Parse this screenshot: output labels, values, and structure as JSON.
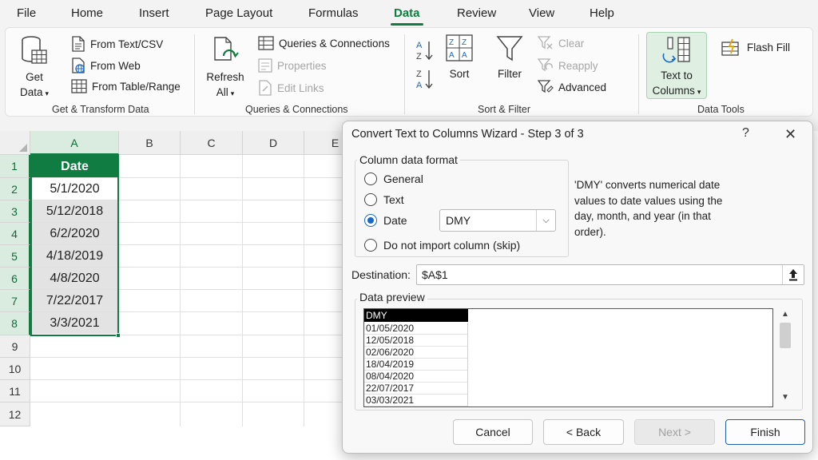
{
  "menu": {
    "tabs": [
      "File",
      "Home",
      "Insert",
      "Page Layout",
      "Formulas",
      "Data",
      "Review",
      "View",
      "Help"
    ],
    "active": "Data"
  },
  "ribbon": {
    "get_transform": {
      "get_data_line1": "Get",
      "get_data_line2": "Data",
      "from_text_csv": "From Text/CSV",
      "from_web": "From Web",
      "from_table_range": "From Table/Range",
      "label": "Get & Transform Data"
    },
    "queries": {
      "refresh_line1": "Refresh",
      "refresh_line2": "All",
      "queries_connections": "Queries & Connections",
      "properties": "Properties",
      "edit_links": "Edit Links",
      "label": "Queries & Connections"
    },
    "sort_filter": {
      "sort": "Sort",
      "filter": "Filter",
      "clear": "Clear",
      "reapply": "Reapply",
      "advanced": "Advanced",
      "label": "Sort & Filter"
    },
    "data_tools": {
      "ttc_line1": "Text to",
      "ttc_line2": "Columns",
      "flash_fill": "Flash Fill",
      "label": "Data Tools"
    }
  },
  "sheet": {
    "columns": [
      "A",
      "B",
      "C",
      "D",
      "E"
    ],
    "rows": [
      "1",
      "2",
      "3",
      "4",
      "5",
      "6",
      "7",
      "8",
      "9",
      "10",
      "11",
      "12"
    ],
    "header": "Date",
    "dates": [
      "5/1/2020",
      "5/12/2018",
      "6/2/2020",
      "4/18/2019",
      "4/8/2020",
      "7/22/2017",
      "3/3/2021"
    ]
  },
  "dialog": {
    "title": "Convert Text to Columns Wizard - Step 3 of 3",
    "help": "?",
    "close": "✕",
    "column_format_legend": "Column data format",
    "radio_general": "General",
    "radio_text": "Text",
    "radio_date": "Date",
    "radio_skip": "Do not import column (skip)",
    "selected_format": "Date",
    "date_format": "DMY",
    "description": "'DMY' converts numerical date values to date values using the day, month, and year (in that order).",
    "destination_label": "Destination:",
    "destination_value": "$A$1",
    "preview_legend": "Data preview",
    "preview_header": "DMY",
    "preview_rows": [
      "01/05/2020",
      "12/05/2018",
      "02/06/2020",
      "18/04/2019",
      "08/04/2020",
      "22/07/2017",
      "03/03/2021"
    ],
    "cancel": "Cancel",
    "back": "< Back",
    "next": "Next >",
    "finish": "Finish"
  }
}
